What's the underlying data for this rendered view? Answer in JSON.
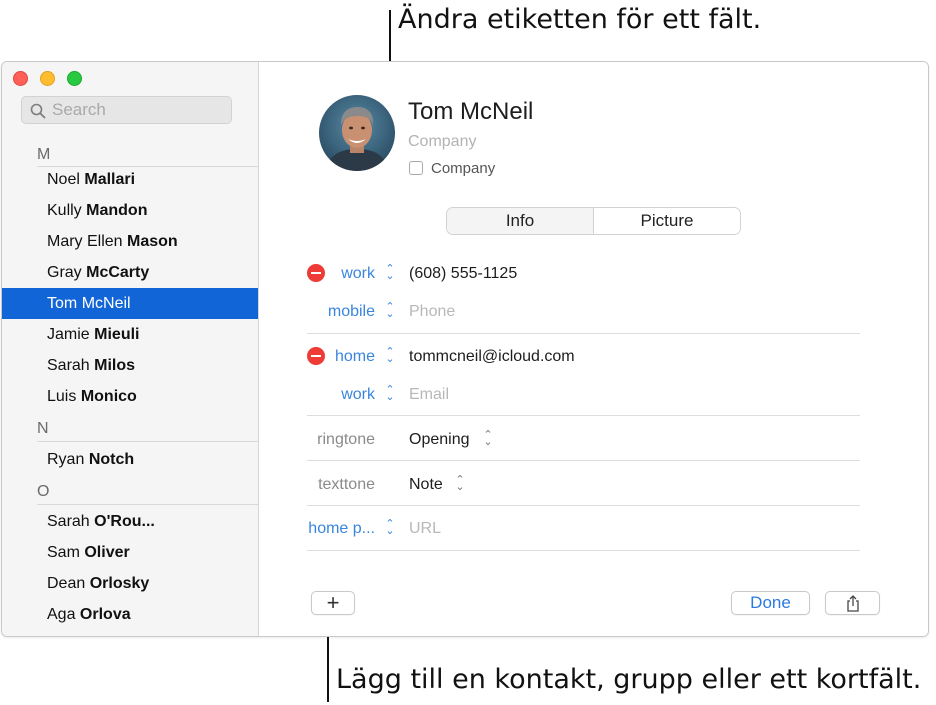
{
  "callouts": {
    "top": "Ändra etiketten för ett fält.",
    "bottom": "Lägg till en kontakt, grupp eller ett kortfält."
  },
  "sidebar": {
    "search_placeholder": "Search",
    "sections": [
      {
        "letter": "M",
        "contacts": [
          {
            "first": "Noel",
            "last": "Mallari"
          },
          {
            "first": "Kully",
            "last": "Mandon"
          },
          {
            "first": "Mary Ellen",
            "last": "Mason"
          },
          {
            "first": "Gray",
            "last": "McCarty"
          },
          {
            "first": "Tom",
            "last": "McNeil",
            "selected": true
          },
          {
            "first": "Jamie",
            "last": "Mieuli"
          },
          {
            "first": "Sarah",
            "last": "Milos"
          },
          {
            "first": "Luis",
            "last": "Monico"
          }
        ]
      },
      {
        "letter": "N",
        "contacts": [
          {
            "first": "Ryan",
            "last": "Notch"
          }
        ]
      },
      {
        "letter": "O",
        "contacts": [
          {
            "first": "Sarah",
            "last": "O'Rou..."
          },
          {
            "first": "Sam",
            "last": "Oliver"
          },
          {
            "first": "Dean",
            "last": "Orlosky"
          },
          {
            "first": "Aga",
            "last": "Orlova"
          }
        ]
      }
    ]
  },
  "card": {
    "first_name": "Tom",
    "last_name": "McNeil",
    "company_placeholder": "Company",
    "company_checkbox_label": "Company",
    "tabs": [
      "Info",
      "Picture"
    ],
    "fields": {
      "phone_work_label": "work",
      "phone_work_value": "(608) 555-1125",
      "phone_mobile_label": "mobile",
      "phone_mobile_placeholder": "Phone",
      "email_home_label": "home",
      "email_home_value": "tommcneil@icloud.com",
      "email_work_label": "work",
      "email_work_placeholder": "Email",
      "ringtone_label": "ringtone",
      "ringtone_value": "Opening",
      "texttone_label": "texttone",
      "texttone_value": "Note",
      "url_label": "home p...",
      "url_placeholder": "URL"
    },
    "buttons": {
      "add": "+",
      "done": "Done"
    }
  },
  "colors": {
    "selection": "#1265d6",
    "label_blue": "#3a85de",
    "delete_red": "#ee3b36"
  },
  "icons": [
    "search-icon",
    "minus-circle-icon",
    "chevron-updown-icon",
    "plus-icon",
    "share-icon"
  ]
}
